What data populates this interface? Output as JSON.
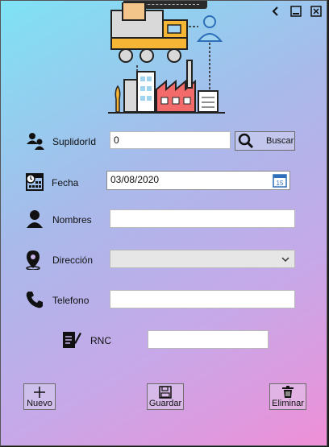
{
  "window": {
    "accent": "#2d6fb8"
  },
  "form": {
    "suplidor_label": "SuplidorId",
    "suplidor_value": "0",
    "buscar_label": "Buscar",
    "fecha_label": "Fecha",
    "fecha_value": "03/08/2020",
    "nombres_label": "Nombres",
    "nombres_value": "",
    "direccion_label": "Dirección",
    "direccion_value": "",
    "telefono_label": "Telefono",
    "telefono_value": "",
    "rnc_label": "RNC",
    "rnc_value": ""
  },
  "actions": {
    "nuevo_label": "Nuevo",
    "guardar_label": "Guardar",
    "eliminar_label": "Eliminar"
  },
  "icons": [
    "back-icon",
    "minimize-icon",
    "close-icon",
    "supplier-illustration",
    "user-group-icon",
    "calendar-sheet-icon",
    "person-icon",
    "location-pin-icon",
    "phone-icon",
    "document-pen-icon",
    "search-icon",
    "calendar-icon",
    "plus-icon",
    "save-icon",
    "trash-icon"
  ]
}
